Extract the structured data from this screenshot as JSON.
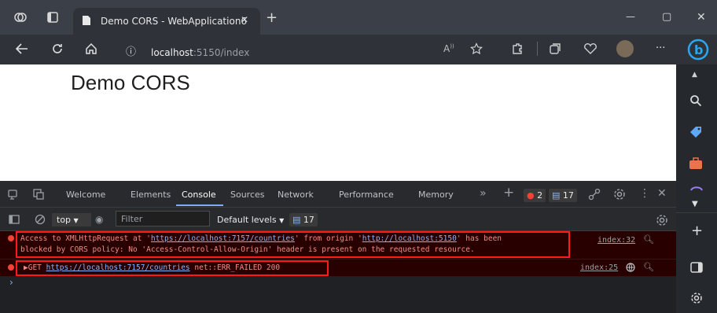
{
  "window": {
    "tab_title": "Demo CORS - WebApplication6",
    "tab_close": "✕",
    "new_tab": "+",
    "minimize": "—",
    "maximize": "▢",
    "close": "✕"
  },
  "address_bar": {
    "host": "localhost",
    "path": ":5150/index",
    "info": "ⓘ",
    "more": "···"
  },
  "page": {
    "heading": "Demo CORS"
  },
  "devtools": {
    "tabs": [
      "Welcome",
      "Elements",
      "Console",
      "Sources",
      "Network",
      "Performance",
      "Memory"
    ],
    "active_tab": "Console",
    "error_count": "2",
    "message_count": "17",
    "context": "top",
    "filter_placeholder": "Filter",
    "levels_label": "Default levels",
    "levels_count": "17",
    "messages": [
      {
        "line1_prefix": "Access to XMLHttpRequest at '",
        "line1_url": "https://localhost:7157/countries",
        "line1_mid": "' from origin '",
        "line1_origin": "http://localhost:5150",
        "line1_suffix": "' has been",
        "line2": "blocked by CORS policy: No 'Access-Control-Allow-Origin' header is present on the requested resource.",
        "source": "index:32"
      },
      {
        "method": "▶GET",
        "url": "https://localhost:7157/countries",
        "status": "net::ERR_FAILED 200",
        "source": "index:25"
      }
    ],
    "prompt": "›"
  },
  "colors": {
    "error_text": "#f28b82",
    "error_bg": "#290000",
    "highlight_box": "#ff1a1a",
    "link": "#8ab4f8"
  }
}
